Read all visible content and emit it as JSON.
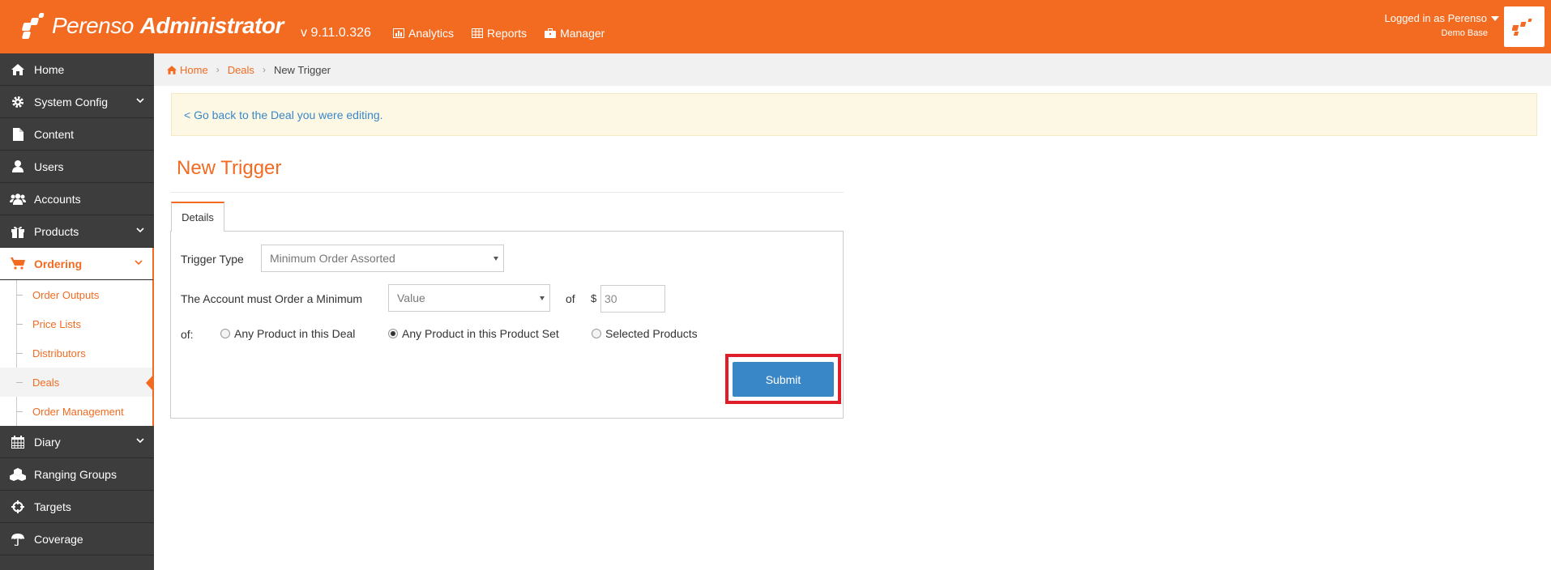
{
  "header": {
    "brand": "Perenso",
    "brand_bold": "Administrator",
    "version": "v 9.11.0.326",
    "nav": [
      {
        "label": "Analytics",
        "icon": "chart-icon"
      },
      {
        "label": "Reports",
        "icon": "table-icon"
      },
      {
        "label": "Manager",
        "icon": "briefcase-icon"
      }
    ],
    "user_label": "Logged in as Perenso",
    "database": "Demo Base"
  },
  "sidebar": {
    "items": [
      {
        "label": "Home",
        "icon": "home-icon"
      },
      {
        "label": "System Config",
        "icon": "gear-icon"
      },
      {
        "label": "Content",
        "icon": "file-icon"
      },
      {
        "label": "Users",
        "icon": "user-icon"
      },
      {
        "label": "Accounts",
        "icon": "users-icon"
      },
      {
        "label": "Products",
        "icon": "gift-icon"
      },
      {
        "label": "Ordering",
        "icon": "cart-icon"
      },
      {
        "label": "Diary",
        "icon": "calendar-icon"
      },
      {
        "label": "Ranging Groups",
        "icon": "cubes-icon"
      },
      {
        "label": "Targets",
        "icon": "crosshairs-icon"
      },
      {
        "label": "Coverage",
        "icon": "umbrella-icon"
      }
    ],
    "ordering_sub": [
      {
        "label": "Order Outputs"
      },
      {
        "label": "Price Lists"
      },
      {
        "label": "Distributors"
      },
      {
        "label": "Deals"
      },
      {
        "label": "Order Management"
      }
    ]
  },
  "breadcrumb": {
    "home": "Home",
    "deals": "Deals",
    "current": "New Trigger"
  },
  "alert": {
    "link": "< Go back to the Deal you were editing."
  },
  "page": {
    "title": "New Trigger",
    "tab": "Details"
  },
  "form": {
    "trigger_type_label": "Trigger Type",
    "trigger_type_value": "Minimum Order Assorted",
    "minimum_label": "The Account must Order a Minimum",
    "minimum_type_value": "Value",
    "of_label": "of",
    "currency": "$",
    "amount_value": "30",
    "of2_label": "of:",
    "radio_any_deal": "Any Product in this Deal",
    "radio_any_set": "Any Product in this Product Set",
    "radio_selected": "Selected Products",
    "selected_radio": "Any Product in this Product Set",
    "submit": "Submit"
  },
  "colors": {
    "brand_orange": "#f26b21",
    "sidebar_dark": "#3d3d3d",
    "submit_blue": "#3a87c8",
    "highlight_red": "#e01e2a",
    "alert_bg": "#fcf8e3"
  }
}
